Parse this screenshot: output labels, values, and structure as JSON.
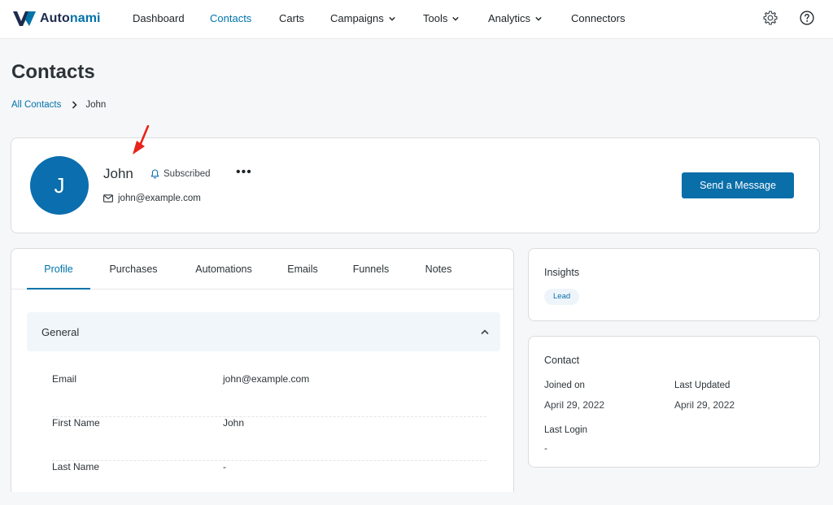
{
  "app": {
    "logo_text_main": "Auto",
    "logo_text_accent": "nami"
  },
  "nav": {
    "items": [
      {
        "label": "Dashboard"
      },
      {
        "label": "Contacts"
      },
      {
        "label": "Carts"
      },
      {
        "label": "Campaigns"
      },
      {
        "label": "Tools"
      },
      {
        "label": "Analytics"
      },
      {
        "label": "Connectors"
      }
    ],
    "active_item": "Contacts"
  },
  "page": {
    "title": "Contacts",
    "breadcrumb": {
      "parent": "All Contacts",
      "current": "John"
    }
  },
  "contact": {
    "avatar_initial": "J",
    "name": "John",
    "status": "Subscribed",
    "email": "john@example.com",
    "send_message_label": "Send a Message"
  },
  "tabs": {
    "items": [
      {
        "label": "Profile"
      },
      {
        "label": "Purchases"
      },
      {
        "label": "Automations"
      },
      {
        "label": "Emails"
      },
      {
        "label": "Funnels"
      },
      {
        "label": "Notes"
      }
    ],
    "active_tab": "Profile"
  },
  "general": {
    "title": "General",
    "fields": [
      {
        "label": "Email",
        "value": "john@example.com"
      },
      {
        "label": "First Name",
        "value": "John"
      },
      {
        "label": "Last Name",
        "value": "-"
      }
    ]
  },
  "insights": {
    "title": "Insights",
    "badge": "Lead"
  },
  "contact_info": {
    "title": "Contact",
    "joined_label": "Joined on",
    "joined_value": "April 29, 2022",
    "updated_label": "Last Updated",
    "updated_value": "April 29, 2022",
    "login_label": "Last Login",
    "login_value": "-"
  },
  "colors": {
    "brand": "#0073aa",
    "primary_button": "#0a6ea9",
    "avatar": "#0b6eae",
    "annotation_arrow": "#e8231b"
  },
  "icons": [
    "autonami-logo-icon",
    "chevron-down-icon",
    "gear-icon",
    "help-icon",
    "chevron-right-icon",
    "bell-icon",
    "more-options-icon",
    "envelope-icon",
    "chevron-up-icon"
  ]
}
